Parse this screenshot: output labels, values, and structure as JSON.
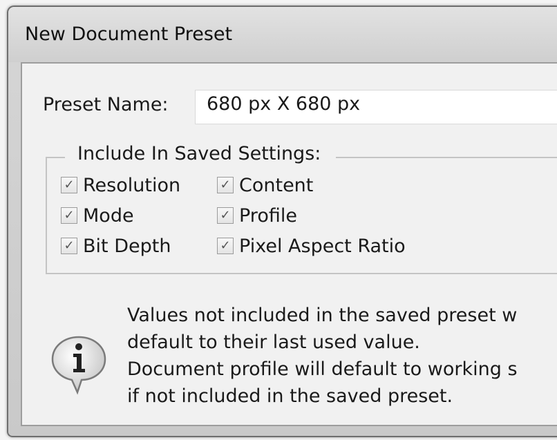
{
  "dialog": {
    "title": "New Document Preset",
    "preset_name_label": "Preset Name:",
    "preset_name_value": "680 px X 680 px",
    "group_label": "Include In Saved Settings:",
    "checkboxes": [
      {
        "label": "Resolution",
        "checked": true
      },
      {
        "label": "Content",
        "checked": true
      },
      {
        "label": "Mode",
        "checked": true
      },
      {
        "label": "Profile",
        "checked": true
      },
      {
        "label": "Bit Depth",
        "checked": true
      },
      {
        "label": "Pixel Aspect Ratio",
        "checked": true
      }
    ],
    "info_icon": "info-icon",
    "info_lines": [
      "Values not included in the saved preset w",
      "default to their last used value.",
      "Document profile will default to working s",
      "if not included in the saved preset."
    ],
    "check_glyph": "✓"
  }
}
